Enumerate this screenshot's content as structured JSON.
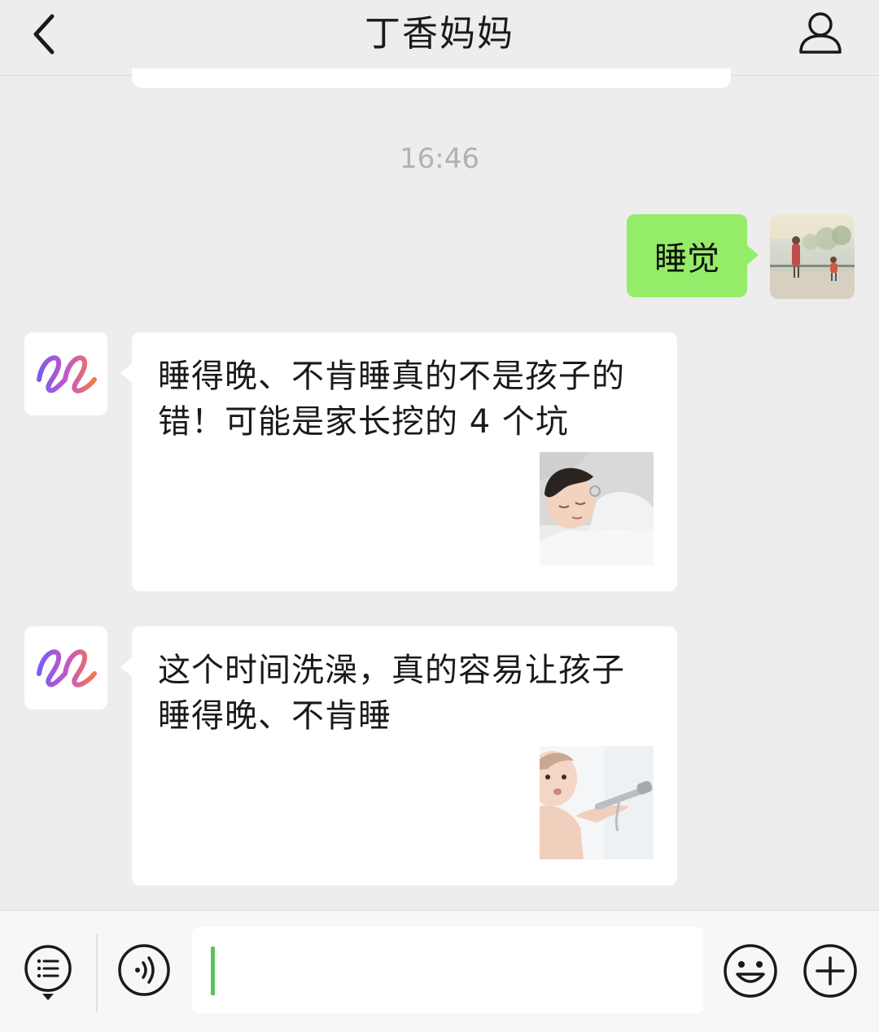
{
  "header": {
    "title": "丁香妈妈",
    "back_icon": "chevron-left-icon",
    "profile_icon": "person-icon"
  },
  "messages": {
    "timestamp": "16:46",
    "outgoing": {
      "text": "睡觉",
      "bubble_color": "#95ec69"
    },
    "incoming": [
      {
        "title": "睡得晚、不肯睡真的不是孩子的错！可能是家长挖的 4 个坑",
        "thumbnail": "sleeping-child-thumbnail"
      },
      {
        "title": "这个时间洗澡，真的容易让孩子睡得晚、不肯睡",
        "thumbnail": "bathing-baby-thumbnail"
      }
    ]
  },
  "inputbar": {
    "value": "",
    "menu_icon": "list-menu-icon",
    "voice_icon": "voice-icon",
    "emoji_icon": "smiley-icon",
    "plus_icon": "plus-icon",
    "caret_color": "#5cc15a"
  }
}
